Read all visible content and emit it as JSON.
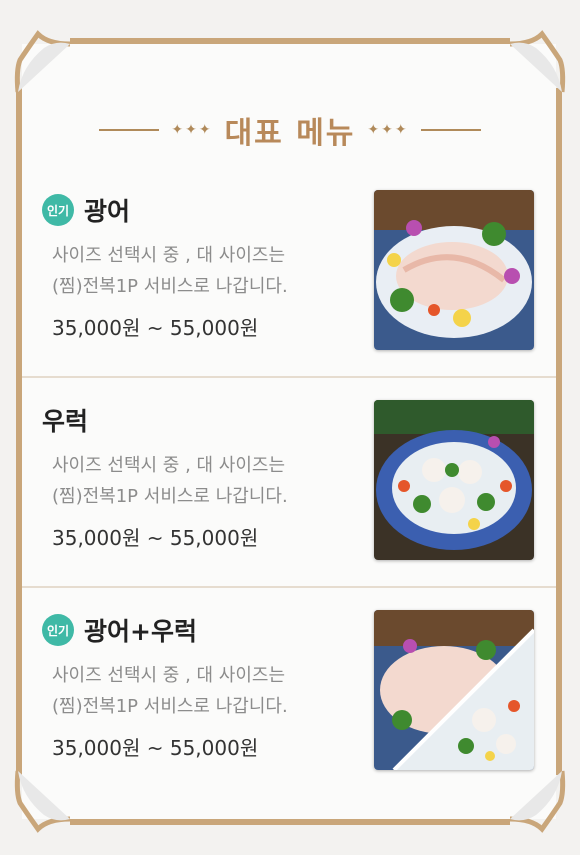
{
  "heading": {
    "title": "대표 메뉴",
    "ornament": "✦✦✦"
  },
  "items": [
    {
      "badge": "인기",
      "name": "광어",
      "desc_line1": "사이즈 선택시 중 , 대 사이즈는",
      "desc_line2": "(찜)전복1P 서비스로 나갑니다.",
      "price": "35,000원 ~ 55,000원",
      "photo_icon": "flatfish-sashimi-platter"
    },
    {
      "badge": "",
      "name": "우럭",
      "desc_line1": "사이즈 선택시 중 , 대 사이즈는",
      "desc_line2": "(찜)전복1P 서비스로 나갑니다.",
      "price": "35,000원 ~ 55,000원",
      "photo_icon": "rockfish-sashimi-platter"
    },
    {
      "badge": "인기",
      "name": "광어+우럭",
      "desc_line1": "사이즈 선택시 중 , 대 사이즈는",
      "desc_line2": "(찜)전복1P 서비스로 나갑니다.",
      "price": "35,000원 ~ 55,000원",
      "photo_icon": "combo-sashimi-platter"
    }
  ],
  "colors": {
    "accent": "#b8895a",
    "badge": "#3fb9a6",
    "frame": "#c9a67a"
  }
}
